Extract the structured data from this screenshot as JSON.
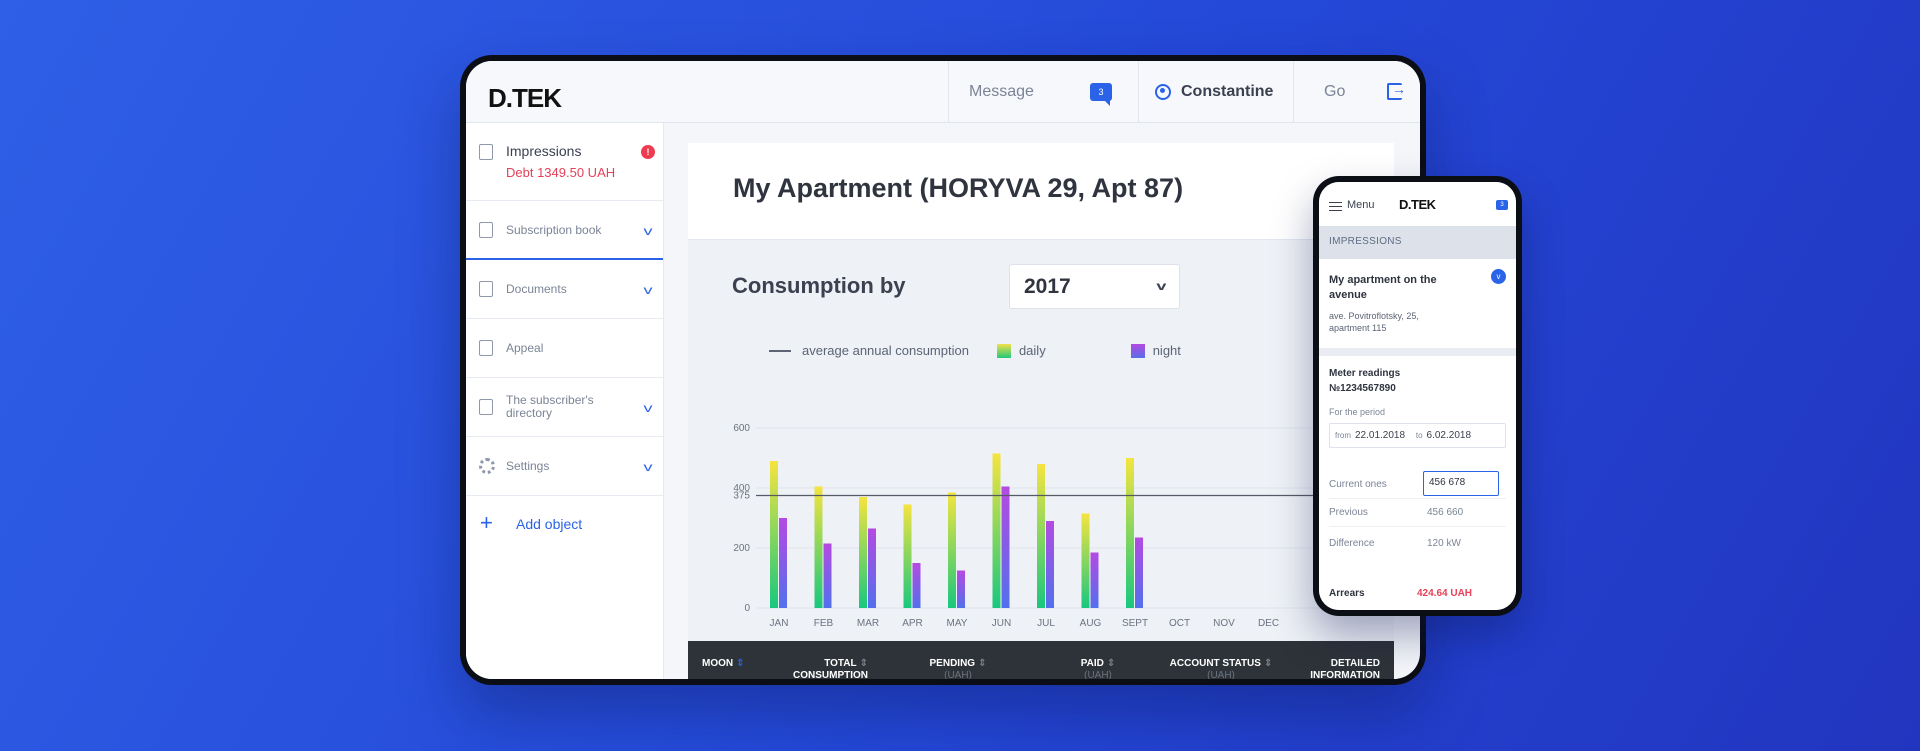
{
  "topbar": {
    "logo_text": "D.TEK",
    "message_label": "Message",
    "message_count": "3",
    "user_name": "Constantine",
    "go_label": "Go"
  },
  "sidebar": {
    "impressions": {
      "label": "Impressions",
      "debt": "Debt 1349.50 UAH",
      "alert": "!"
    },
    "items": [
      {
        "label": "Subscription book",
        "icon": "book-icon"
      },
      {
        "label": "Documents",
        "icon": "document-icon"
      },
      {
        "label": "Appeal",
        "icon": "chat-icon"
      },
      {
        "label": "The subscriber's directory",
        "icon": "directory-icon"
      },
      {
        "label": "Settings",
        "icon": "gear-icon"
      }
    ],
    "add_object": "Add object"
  },
  "main": {
    "title": "My Apartment (HORYVA 29, Apt 87)",
    "consumption_title": "Consumption by",
    "year": "2017",
    "legend": {
      "average": "average annual consumption",
      "daily": "daily",
      "night": "night"
    }
  },
  "chart_data": {
    "type": "bar",
    "categories": [
      "JAN",
      "FEB",
      "MAR",
      "APR",
      "MAY",
      "JUN",
      "JUL",
      "AUG",
      "SEPT",
      "OCT",
      "NOV",
      "DEC"
    ],
    "series": [
      {
        "name": "daily",
        "values": [
          490,
          405,
          370,
          345,
          385,
          515,
          480,
          315,
          500,
          null,
          null,
          null
        ]
      },
      {
        "name": "night",
        "values": [
          300,
          215,
          265,
          150,
          125,
          405,
          290,
          185,
          235,
          null,
          null,
          null
        ]
      }
    ],
    "reference_line": {
      "name": "average annual consumption",
      "value": 375
    },
    "yticks": [
      0,
      200,
      375,
      400,
      600
    ],
    "ylim": [
      0,
      600
    ],
    "colors": {
      "daily_top": "#f5e43f",
      "daily_bottom": "#19c77e",
      "night_top": "#b54ae2",
      "night_bottom": "#5270eb"
    }
  },
  "table": {
    "columns": [
      {
        "label": "MOON",
        "sub": ""
      },
      {
        "label": "TOTAL",
        "label2": "CONSUMPTION",
        "sub": ""
      },
      {
        "label": "PENDING",
        "sub": "(UAH)"
      },
      {
        "label": "PAID",
        "sub": "(UAH)"
      },
      {
        "label": "ACCOUNT STATUS",
        "sub": "(UAH)"
      },
      {
        "label": "DETAILED",
        "label2": "INFORMATION",
        "sub": ""
      }
    ]
  },
  "phone": {
    "menu_label": "Menu",
    "logo_text": "D.TEK",
    "badge": "3",
    "section_label": "IMPRESSIONS",
    "apartment_title": "My apartment on the avenue",
    "apartment_address": "ave. Povitroflotsky, 25, apartment 115",
    "meter_title": "Meter readings",
    "meter_number": "№1234567890",
    "period_label": "For the period",
    "from_label": "from",
    "from_date": "22.01.2018",
    "to_label": "to",
    "to_date": "6.02.2018",
    "current_label": "Current ones",
    "current_value": "456 678",
    "previous_label": "Previous",
    "previous_value": "456 660",
    "difference_label": "Difference",
    "difference_value": "120 kW",
    "arrears_label": "Arrears",
    "arrears_value": "424.64 UAH"
  },
  "colors": {
    "accent": "#2a63e8",
    "debt": "#e5415a",
    "background": "#2b52df"
  }
}
